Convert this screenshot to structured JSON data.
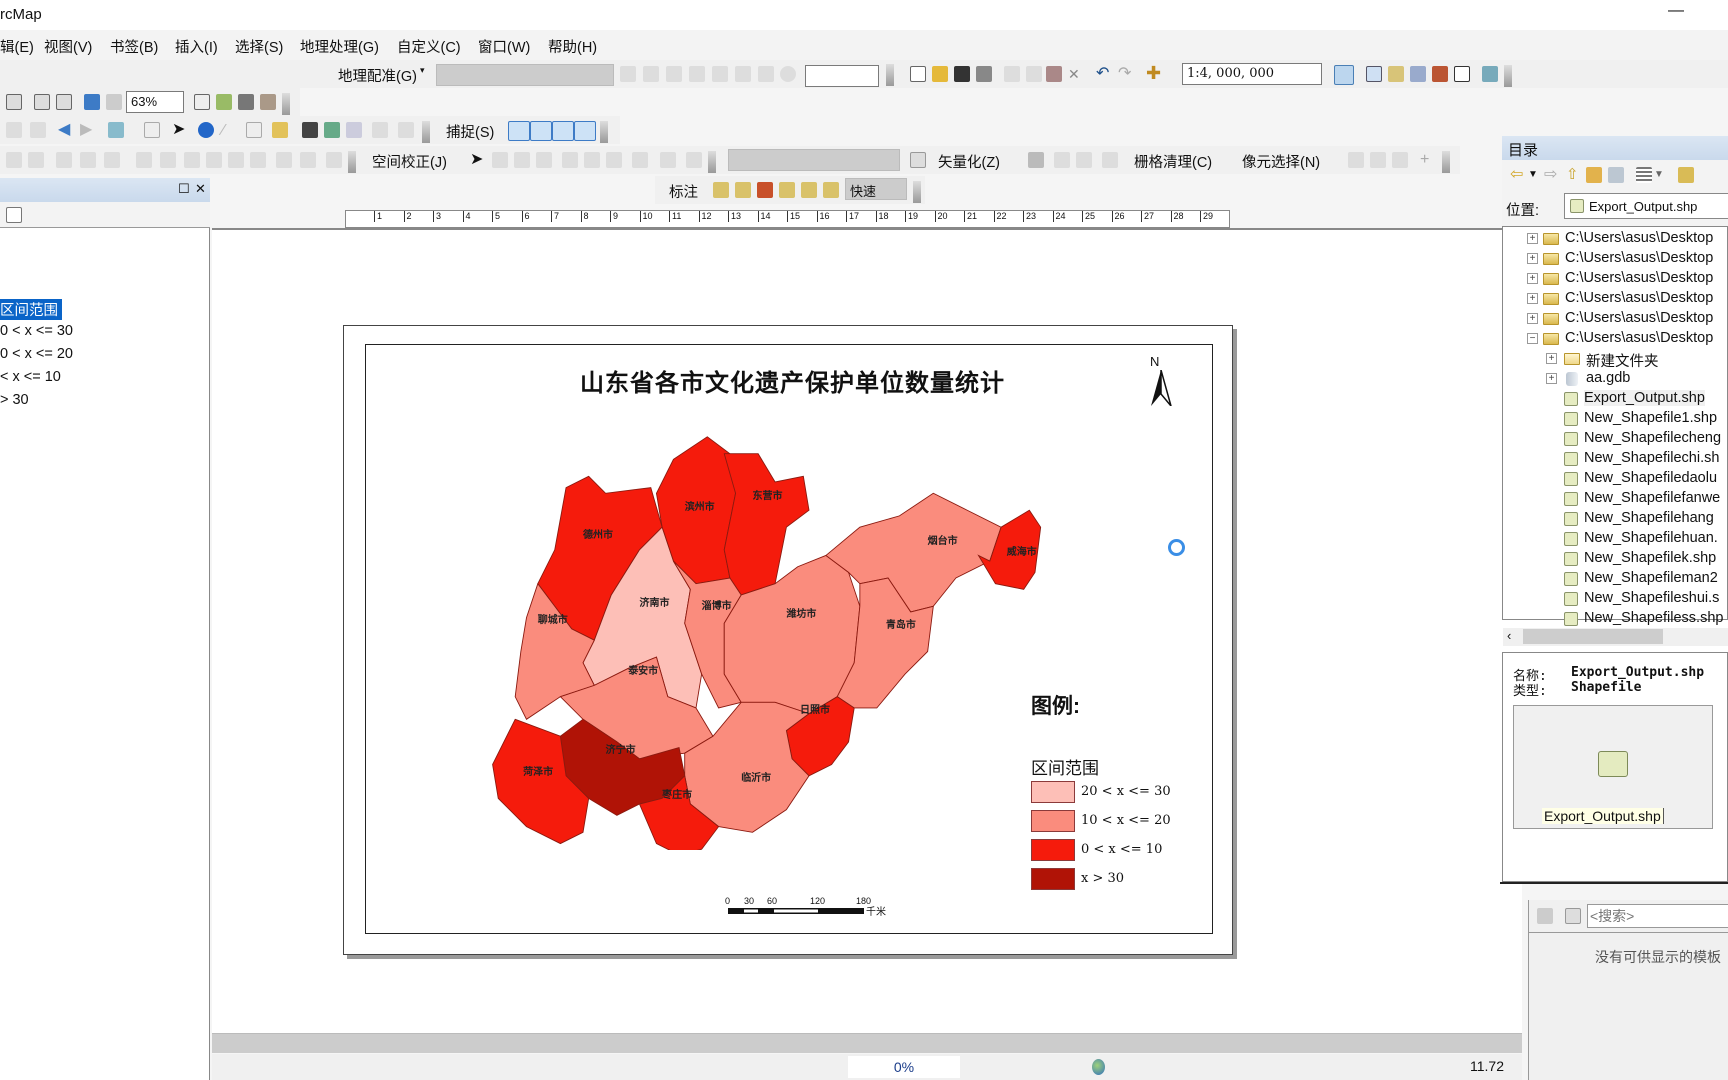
{
  "window": {
    "title": "rcMap"
  },
  "menu": [
    "辑(E)",
    "视图(V)",
    "书签(B)",
    "插入(I)",
    "选择(S)",
    "地理处理(G)",
    "自定义(C)",
    "窗口(W)",
    "帮助(H)"
  ],
  "toolbars": {
    "georef_label": "地理配准(G)",
    "scale_value": "1:4, 000, 000",
    "zoom_value": "63%",
    "snapping_label": "捕捉(S)",
    "spatial_adjust_label": "空间校正(J)",
    "vectorize_label": "矢量化(Z)",
    "raster_cleanup_label": "栅格清理(C)",
    "cell_select_label": "像元选择(N)",
    "label_label": "标注",
    "quick_value": "快速"
  },
  "ruler": {
    "ticks": [
      "1",
      "2",
      "3",
      "4",
      "5",
      "6",
      "7",
      "8",
      "9",
      "10",
      "11",
      "12",
      "13",
      "14",
      "15",
      "16",
      "17",
      "18",
      "19",
      "20",
      "21",
      "22",
      "23",
      "24",
      "25",
      "26",
      "27",
      "28",
      "29"
    ]
  },
  "toc": {
    "heading": "区间范围",
    "items": [
      "0 < x <= 30",
      "0 < x <= 20",
      "< x <= 10",
      "> 30"
    ]
  },
  "map": {
    "title": "山东省各市文化遗产保护单位数量统计",
    "north_label": "N",
    "legend_title": "图例:",
    "legend_subtitle": "区间范围",
    "legend": [
      {
        "label": "20 < x <= 30",
        "color": "#fdbfb7"
      },
      {
        "label": "10 < x <= 20",
        "color": "#fa8c7d"
      },
      {
        "label": "0 < x <= 10",
        "color": "#f51b0c"
      },
      {
        "label": "x > 30",
        "color": "#b01306"
      }
    ],
    "scalebar": {
      "ticks": [
        "0",
        "30",
        "60",
        "120",
        "180"
      ],
      "unit": "千米"
    },
    "cities": [
      {
        "name": "滨州市",
        "class": 2
      },
      {
        "name": "东营市",
        "class": 2
      },
      {
        "name": "德州市",
        "class": 2
      },
      {
        "name": "济南市",
        "class": 0
      },
      {
        "name": "淄博市",
        "class": 1
      },
      {
        "name": "潍坊市",
        "class": 1
      },
      {
        "name": "烟台市",
        "class": 1
      },
      {
        "name": "威海市",
        "class": 2
      },
      {
        "name": "聊城市",
        "class": 1
      },
      {
        "name": "青岛市",
        "class": 1
      },
      {
        "name": "泰安市",
        "class": 1
      },
      {
        "name": "日照市",
        "class": 2
      },
      {
        "name": "济宁市",
        "class": 3
      },
      {
        "name": "菏泽市",
        "class": 2
      },
      {
        "name": "临沂市",
        "class": 1
      },
      {
        "name": "枣庄市",
        "class": 2
      }
    ]
  },
  "catalog": {
    "title": "目录",
    "location_label": "位置:",
    "location_value": "Export_Output.shp",
    "tree": [
      {
        "label": "C:\\Users\\asus\\Desktop",
        "type": "folder",
        "expanded": false
      },
      {
        "label": "C:\\Users\\asus\\Desktop",
        "type": "folder",
        "expanded": false
      },
      {
        "label": "C:\\Users\\asus\\Desktop",
        "type": "folder",
        "expanded": false
      },
      {
        "label": "C:\\Users\\asus\\Desktop",
        "type": "folder",
        "expanded": false
      },
      {
        "label": "C:\\Users\\asus\\Desktop",
        "type": "folder",
        "expanded": false
      },
      {
        "label": "C:\\Users\\asus\\Desktop",
        "type": "folder",
        "expanded": true
      },
      {
        "label": "新建文件夹",
        "type": "subfolder"
      },
      {
        "label": "aa.gdb",
        "type": "gdb"
      },
      {
        "label": "Export_Output.shp",
        "type": "polygon"
      },
      {
        "label": "New_Shapefile1.shp",
        "type": "point"
      },
      {
        "label": "New_Shapefilecheng",
        "type": "line"
      },
      {
        "label": "New_Shapefilechi.sh",
        "type": "polygon"
      },
      {
        "label": "New_Shapefiledaolu",
        "type": "line"
      },
      {
        "label": "New_Shapefilefanwe",
        "type": "polygon"
      },
      {
        "label": "New_Shapefilehang",
        "type": "polygon"
      },
      {
        "label": "New_Shapefilehuan.",
        "type": "polygon"
      },
      {
        "label": "New_Shapefilek.shp",
        "type": "line"
      },
      {
        "label": "New_Shapefileman2",
        "type": "point"
      },
      {
        "label": "New_Shapefileshui.s",
        "type": "line"
      },
      {
        "label": "New_Shapefiless.shp",
        "type": "polygon"
      }
    ],
    "info_name_label": "名称:",
    "info_name_value": "Export_Output.shp",
    "info_type_label": "类型:",
    "info_type_value": "Shapefile",
    "preview_caption": "Export_Output.shp"
  },
  "search": {
    "placeholder": "<搜索>",
    "empty_message": "没有可供显示的模板"
  },
  "status": {
    "progress": "0%",
    "coords": "11.72"
  }
}
